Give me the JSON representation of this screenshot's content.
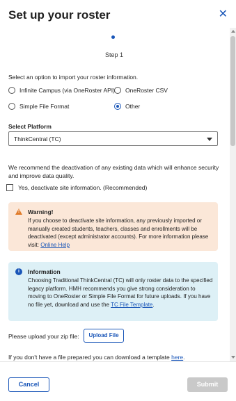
{
  "dialog": {
    "title": "Set up your roster",
    "close_glyph": "✕"
  },
  "step": {
    "label": "Step 1",
    "current": 1
  },
  "import": {
    "prompt": "Select an option to import your roster information.",
    "options": [
      {
        "label": "Infinite Campus (via OneRoster API)",
        "selected": false
      },
      {
        "label": "OneRoster CSV",
        "selected": false
      },
      {
        "label": "Simple File Format",
        "selected": false
      },
      {
        "label": "Other",
        "selected": true
      }
    ]
  },
  "platform": {
    "label": "Select Platform",
    "value": "ThinkCentral (TC)"
  },
  "deactivate": {
    "recommendation": "We recommend the deactivation of any existing data which will enhance security and improve data quality.",
    "checkbox_label": "Yes, deactivate site information. (Recommended)",
    "checked": false
  },
  "warning": {
    "title": "Warning!",
    "body": "If you choose to deactivate site information, any previously imported or manually created students, teachers, classes and enrollments will be deactivated (except administrator accounts). For more information please visit: ",
    "link": "Online Help"
  },
  "information": {
    "title": "Information",
    "body": "Choosing Traditional ThinkCentral (TC) will only roster data to the specified legacy platform. HMH recommends you give strong consideration to moving to OneRoster or Simple File Format for future uploads. If you have no file yet, download and use the ",
    "link": "TC File Template",
    "suffix": "."
  },
  "upload": {
    "label": "Please upload your zip file:",
    "button": "Upload File"
  },
  "template": {
    "text": "If you don't have a file prepared you can download a template ",
    "link": "here",
    "suffix": "."
  },
  "footer": {
    "cancel": "Cancel",
    "submit": "Submit"
  },
  "colors": {
    "accent": "#1a56b8",
    "warning_bg": "#fbe7d8",
    "info_bg": "#ddf0f6",
    "disabled": "#c9c9c9"
  }
}
